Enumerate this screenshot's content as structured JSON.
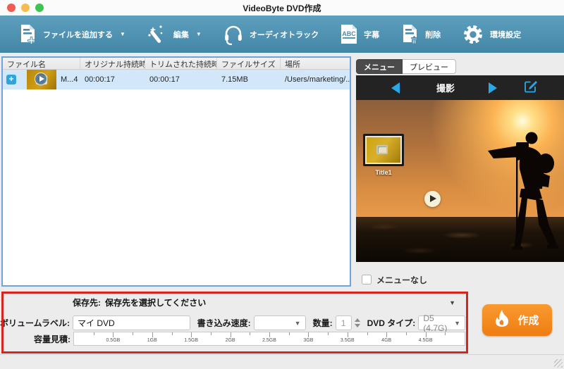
{
  "window": {
    "title": "VideoByte DVD作成"
  },
  "toolbar": {
    "caret": "▼",
    "buttons": [
      {
        "label": "ファイルを追加する",
        "caret": true
      },
      {
        "label": "編集",
        "caret": true
      },
      {
        "label": "オーディオトラック",
        "caret": false
      },
      {
        "label": "字幕",
        "caret": false
      },
      {
        "label": "削除",
        "caret": false
      },
      {
        "label": "環境設定",
        "caret": false
      }
    ]
  },
  "file_table": {
    "columns": [
      "ファイル名",
      "オリジナル持続時間",
      "トリムされた持続時間",
      "ファイルサイズ",
      "場所"
    ],
    "rows": [
      {
        "name": "M...4",
        "original_duration": "00:00:17",
        "trimmed_duration": "00:00:17",
        "size": "7.15MB",
        "location": "/Users/marketing/...",
        "add_glyph": "+"
      }
    ]
  },
  "preview_panel": {
    "tabs": [
      {
        "label": "メニュー",
        "active": true
      },
      {
        "label": "プレビュー",
        "active": false
      }
    ],
    "template_name": "撮影",
    "thumbnail_label": "Title1",
    "no_menu_label": "メニューなし",
    "no_menu_checked": false
  },
  "bottom_panel": {
    "destination": {
      "label": "保存先:",
      "value": "保存先を選択してください",
      "caret": "▼"
    },
    "volume": {
      "label": "ボリュームラベル:",
      "value": "マイ DVD"
    },
    "burn_speed": {
      "label": "書き込み速度:",
      "value": "",
      "caret": "▼"
    },
    "quantity": {
      "label": "数量:",
      "value": "1"
    },
    "dvd_type": {
      "label": "DVD タイプ:",
      "value": "D5 (4.7G)",
      "caret": "▼"
    },
    "capacity": {
      "label": "容量見積:",
      "tick_labels": [
        "0.5GB",
        "1GB",
        "1.5GB",
        "2GB",
        "2.5GB",
        "3GB",
        "3.5GB",
        "4GB",
        "4.5GB"
      ]
    },
    "create_button": "作成"
  },
  "colors": {
    "toolbar_top": "#5d9fbd",
    "toolbar_bottom": "#4486a6",
    "accent_blue": "#2da5e1",
    "annotation_red": "#d6251f",
    "create_orange": "#f68a1f",
    "selected_row": "#d2e8fa",
    "focus_border": "#6ea3dc",
    "nav_arrow": "#2aa7e8"
  }
}
